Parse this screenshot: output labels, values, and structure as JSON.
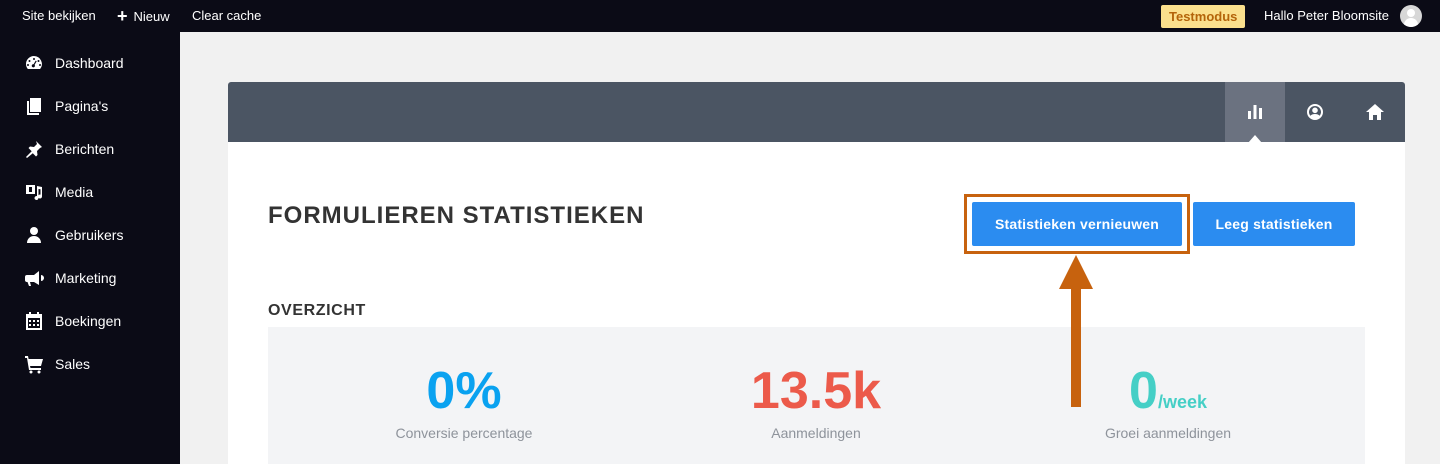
{
  "topbar": {
    "site_label": "Site bekijken",
    "new_label": "Nieuw",
    "cache_label": "Clear cache",
    "mode_badge": "Testmodus",
    "greeting": "Hallo Peter Bloomsite"
  },
  "sidebar": {
    "items": [
      {
        "label": "Dashboard",
        "icon": "dashboard-icon"
      },
      {
        "label": "Pagina's",
        "icon": "pages-icon"
      },
      {
        "label": "Berichten",
        "icon": "pin-icon"
      },
      {
        "label": "Media",
        "icon": "media-icon"
      },
      {
        "label": "Gebruikers",
        "icon": "user-icon"
      },
      {
        "label": "Marketing",
        "icon": "megaphone-icon"
      },
      {
        "label": "Boekingen",
        "icon": "calendar-icon"
      },
      {
        "label": "Sales",
        "icon": "cart-icon"
      }
    ]
  },
  "panel": {
    "tabs": [
      {
        "icon": "bar-chart-icon",
        "active": true
      },
      {
        "icon": "user-circle-icon",
        "active": false
      },
      {
        "icon": "home-icon",
        "active": false
      }
    ],
    "title": "FORMULIEREN STATISTIEKEN",
    "refresh_button": "Statistieken vernieuwen",
    "clear_button": "Leeg statistieken",
    "overview_title": "OVERZICHT",
    "stats": [
      {
        "value": "0%",
        "unit": "",
        "label": "Conversie percentage",
        "color": "#0aa2f0"
      },
      {
        "value": "13.5k",
        "unit": "",
        "label": "Aanmeldingen",
        "color": "#ec5a4a"
      },
      {
        "value": "0",
        "unit": "/week",
        "label": "Groei aanmeldingen",
        "color": "#45cfc6"
      }
    ]
  },
  "colors": {
    "accent": "#2b8cf0",
    "highlight": "#c7620e",
    "admin_bar": "#0b0b16",
    "panel_header": "#4b5563"
  }
}
